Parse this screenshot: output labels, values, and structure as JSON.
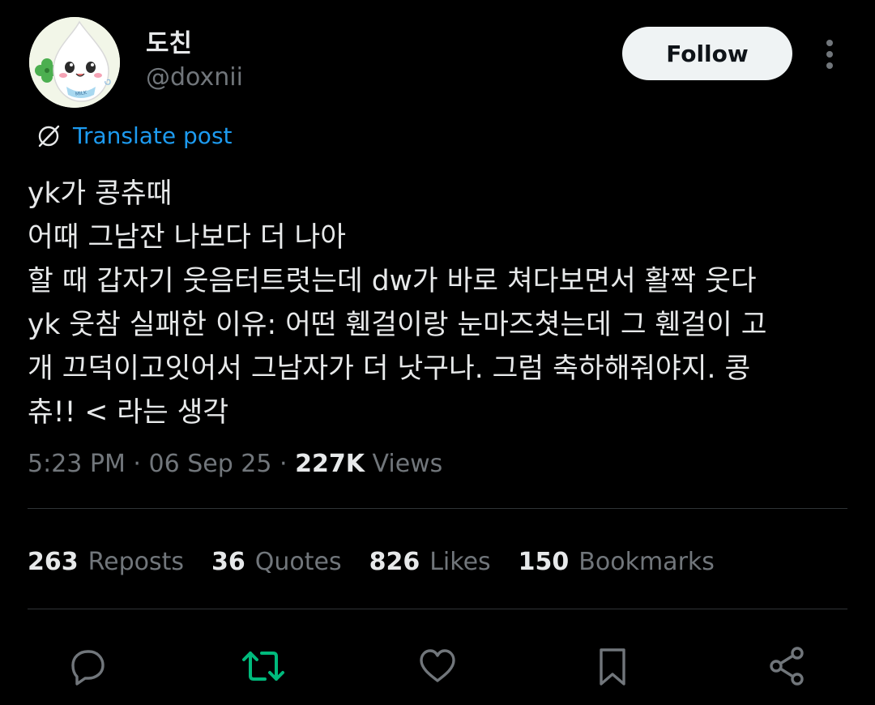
{
  "author": {
    "display_name": "도친",
    "handle": "@doxnii",
    "avatar_icon": "milk-drop-character-avatar",
    "avatar_badge_text": "MILK"
  },
  "header": {
    "follow_label": "Follow",
    "more_icon": "more-vertical-icon"
  },
  "translate": {
    "icon": "translate-globe-icon",
    "label": "Translate post"
  },
  "tweet": {
    "lines": [
      "yk가 콩츄때",
      "어때 그남잔 나보다 더 나아",
      "할 때 갑자기 웃음터트렷는데 dw가 바로 쳐다보면서 활짝 웃다",
      "yk 웃참 실패한 이유: 어떤 휀걸이랑 눈마즈쳣는데 그 휀걸이 고",
      "개 끄덕이고잇어서 그남자가 더 낫구나. 그럼 축하해줘야지. 콩",
      "츄!! < 라는 생각"
    ]
  },
  "meta": {
    "time": "5:23 PM",
    "separator": " · ",
    "date": "06 Sep 25",
    "views_count": "227K",
    "views_label": " Views"
  },
  "stats": [
    {
      "count": "263",
      "label": "Reposts"
    },
    {
      "count": "36",
      "label": "Quotes"
    },
    {
      "count": "826",
      "label": "Likes"
    },
    {
      "count": "150",
      "label": "Bookmarks"
    }
  ],
  "actions": [
    {
      "icon": "reply-icon",
      "color": "#71767b"
    },
    {
      "icon": "repost-icon",
      "color": "#00ba7c"
    },
    {
      "icon": "like-icon",
      "color": "#71767b"
    },
    {
      "icon": "bookmark-icon",
      "color": "#71767b"
    },
    {
      "icon": "share-icon",
      "color": "#71767b"
    }
  ],
  "colors": {
    "background": "#000000",
    "text_primary": "#e7e9ea",
    "text_secondary": "#71767b",
    "link": "#1d9bf0",
    "repost_active": "#00ba7c",
    "divider": "#2f3336"
  }
}
